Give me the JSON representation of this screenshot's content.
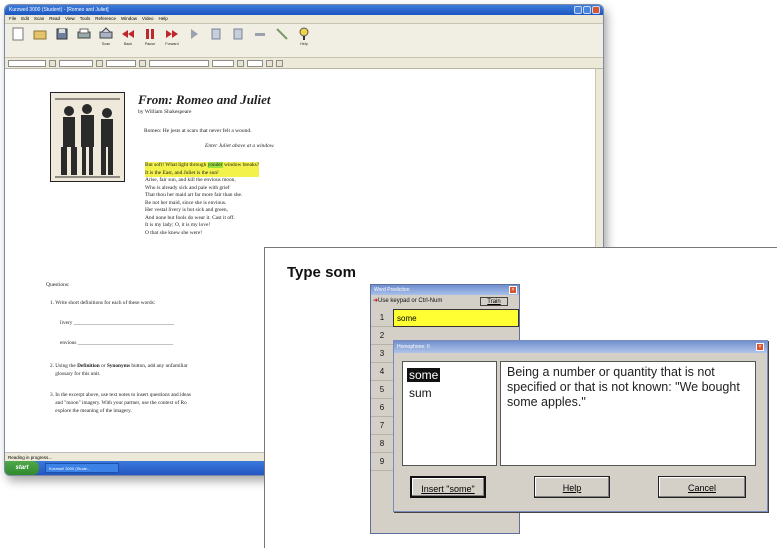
{
  "app": {
    "title": "Kurzweil 3000 (Student) - [Romeo and Juliet]",
    "menu": [
      "File",
      "Edit",
      "Scan",
      "Read",
      "View",
      "Tools",
      "Reference",
      "Window",
      "Video",
      "Help"
    ],
    "toolbar": [
      {
        "label": "",
        "icon": "document-icon"
      },
      {
        "label": "",
        "icon": "folder-icon"
      },
      {
        "label": "",
        "icon": "save-icon"
      },
      {
        "label": "",
        "icon": "print-icon"
      },
      {
        "label": "Scan",
        "icon": "scanner-icon"
      },
      {
        "label": "Back",
        "icon": "rewind-icon"
      },
      {
        "label": "Pause",
        "icon": "pause-icon"
      },
      {
        "label": "Forward",
        "icon": "fast-forward-icon"
      },
      {
        "label": "",
        "icon": "play-icon"
      },
      {
        "label": "",
        "icon": "page-icon"
      },
      {
        "label": "",
        "icon": "page-icon"
      },
      {
        "label": "",
        "icon": "highlighter-icon"
      },
      {
        "label": "",
        "icon": "arrow-icon"
      },
      {
        "label": "Help",
        "icon": "help-icon"
      }
    ],
    "status": "Reading in progress...",
    "taskbar": {
      "start": "start",
      "task": "Kurzweil 3000 (Stude..."
    },
    "colors": {
      "titlebar": "#1b56c2",
      "taskbar": "#2455c1",
      "start": "#3a9a37",
      "highlight_yellow": "#f2f24a",
      "highlight_green": "#9be23d"
    }
  },
  "document": {
    "title": "From: Romeo and Juliet",
    "author": "by William Shakespeare",
    "romeo_line": "Romeo: He jests at scars that never felt a wound.",
    "stage_direction": "Enter Juliet above at a window.",
    "poem_first_before": "But soft! What light through ",
    "poem_first_word": "yonder",
    "poem_first_after": " window breaks?",
    "poem_second": "It is the East, and Juliet is the sun!",
    "poem_rest": [
      "Arise, fair sun, and kill the envious moon,",
      "Who is already sick and pale with grief",
      "That thou her maid art far more fair than she.",
      "Be not her maid, since she is envious.",
      "Her vestal livery is but sick and green,",
      "And none but fools do wear it. Cast it off.",
      "It is my lady; O, it is my love!",
      "O that she knew she were!"
    ],
    "questions_heading": "Questions:",
    "q1": "1.  Write short definitions for each of these words:",
    "word1": "livery",
    "word2": "envious",
    "q2_before": "2.  Using the ",
    "q2_b1": "Definition",
    "q2_mid": " or ",
    "q2_b2": "Synonyms",
    "q2_after": " button, add any unfamiliar",
    "q2_line2": "glossary for this unit.",
    "q3_line1": "3.  In the excerpt above, use text notes to insert questions and ideas",
    "q3_line2": "and \"moon\" imagery. With your partner, use the context of Ro",
    "q3_line3": "explore the meaning of the imagery."
  },
  "zoom": {
    "typed_text": "Type som",
    "word_prediction": {
      "title": "Word Prediction",
      "use_keypad": "Use keypad or Ctrl-Num",
      "train": "Train",
      "rows": [
        "1",
        "2",
        "3",
        "4",
        "5",
        "6",
        "7",
        "8",
        "9"
      ],
      "first_word": "some"
    },
    "homophone": {
      "title": "Homophone: II",
      "words": [
        "some",
        "sum"
      ],
      "definition": "Being a number or quantity that is not specified or that is not known: \"We bought some apples.\"",
      "buttons": {
        "insert": "Insert \"some\"",
        "help": "Help",
        "cancel": "Cancel"
      }
    }
  }
}
